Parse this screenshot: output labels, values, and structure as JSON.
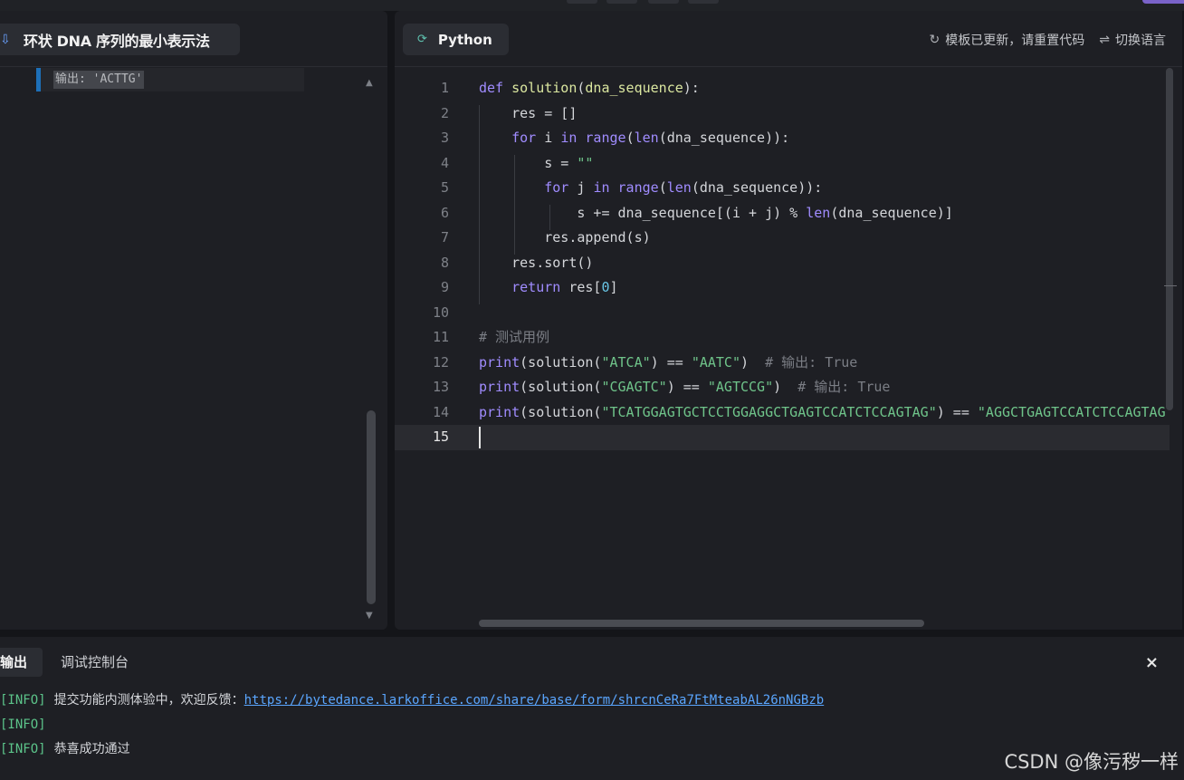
{
  "problem": {
    "title": "环状 DNA 序列的最小表示法",
    "description_line": "输出: 'ACTTG'"
  },
  "editor": {
    "language": "Python",
    "actions": [
      {
        "icon": "refresh-icon",
        "label": "模板已更新，请重置代码"
      },
      {
        "icon": "switch-icon",
        "label": "切换语言"
      }
    ],
    "line_numbers": [
      "1",
      "2",
      "3",
      "4",
      "5",
      "6",
      "7",
      "8",
      "9",
      "10",
      "11",
      "12",
      "13",
      "14",
      "15"
    ],
    "current_line": "15"
  },
  "output": {
    "tabs": [
      "输出",
      "调试控制台"
    ],
    "close_label": "×",
    "logs": [
      {
        "tag": "[INFO]",
        "message": "提交功能内测体验中，欢迎反馈：",
        "link": "https://bytedance.larkoffice.com/share/base/form/shrcnCeRa7FtMteabAL26nNGBzb"
      },
      {
        "tag": "[INFO]",
        "message": "",
        "link": ""
      },
      {
        "tag": "[INFO]",
        "message": "恭喜成功通过",
        "link": ""
      }
    ]
  },
  "watermark": "CSDN @像污秽一样"
}
